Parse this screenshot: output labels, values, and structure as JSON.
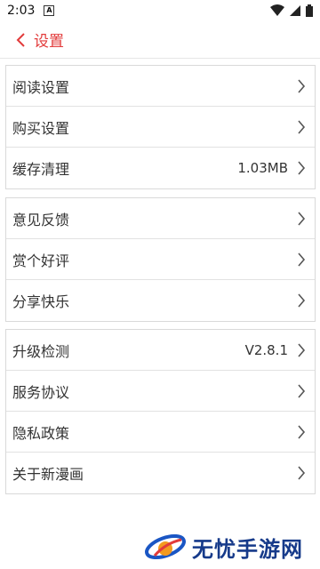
{
  "status": {
    "time": "2:03",
    "notif": "A"
  },
  "header": {
    "title": "设置"
  },
  "groups": [
    {
      "rows": [
        {
          "label": "阅读设置",
          "value": ""
        },
        {
          "label": "购买设置",
          "value": ""
        },
        {
          "label": "缓存清理",
          "value": "1.03MB"
        }
      ]
    },
    {
      "rows": [
        {
          "label": "意见反馈",
          "value": ""
        },
        {
          "label": "赏个好评",
          "value": ""
        },
        {
          "label": "分享快乐",
          "value": ""
        }
      ]
    },
    {
      "rows": [
        {
          "label": "升级检测",
          "value": "V2.8.1"
        },
        {
          "label": "服务协议",
          "value": ""
        },
        {
          "label": "隐私政策",
          "value": ""
        },
        {
          "label": "关于新漫画",
          "value": ""
        }
      ]
    }
  ],
  "watermark": {
    "text": "无忧手游网"
  },
  "colors": {
    "accent": "#e23b3b",
    "chevron": "#555555"
  },
  "icons": [
    "back-chevron",
    "row-chevron",
    "wifi",
    "signal",
    "battery"
  ]
}
